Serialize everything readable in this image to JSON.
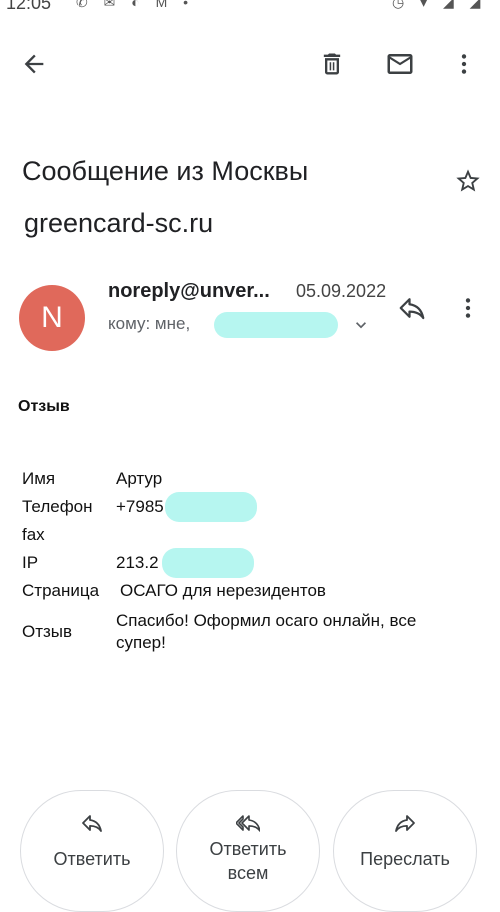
{
  "status_bar": {
    "time": "12:05",
    "left_icons": "✆ ✉ ◐ M •",
    "right_icons": "◷ ▾ ◢ ◢"
  },
  "toolbar": {
    "back_icon": "arrow-back-icon",
    "delete_icon": "trash-icon",
    "mark_unread_icon": "envelope-icon",
    "more_icon": "more-vert-icon"
  },
  "message": {
    "subject": "Сообщение из Москвы",
    "label": "greencard-sc.ru",
    "star_icon": "star-outline-icon",
    "avatar_letter": "N",
    "avatar_color": "#e0695b",
    "sender": "noreply@unver...",
    "date": "05.09.2022",
    "recipients": "кому: мне,",
    "reply_icon": "reply-icon"
  },
  "body": {
    "heading": "Отзыв",
    "fields": [
      {
        "label": "Имя",
        "value": "Артур"
      },
      {
        "label": "Телефон",
        "value": "+7985"
      },
      {
        "label": "fax",
        "value": ""
      },
      {
        "label": "IP",
        "value": "213.2"
      },
      {
        "label": "Страница",
        "value": "ОСАГО для нерезидентов"
      },
      {
        "label": "Отзыв",
        "value": "Спасибо! Оформил осаго онлайн, все супер!"
      }
    ]
  },
  "actions": {
    "reply": "Ответить",
    "reply_all_line1": "Ответить",
    "reply_all_line2": "всем",
    "forward": "Переслать"
  },
  "colors": {
    "redaction": "#b6f6f0",
    "text": "#202124",
    "secondary": "#5f6368"
  }
}
